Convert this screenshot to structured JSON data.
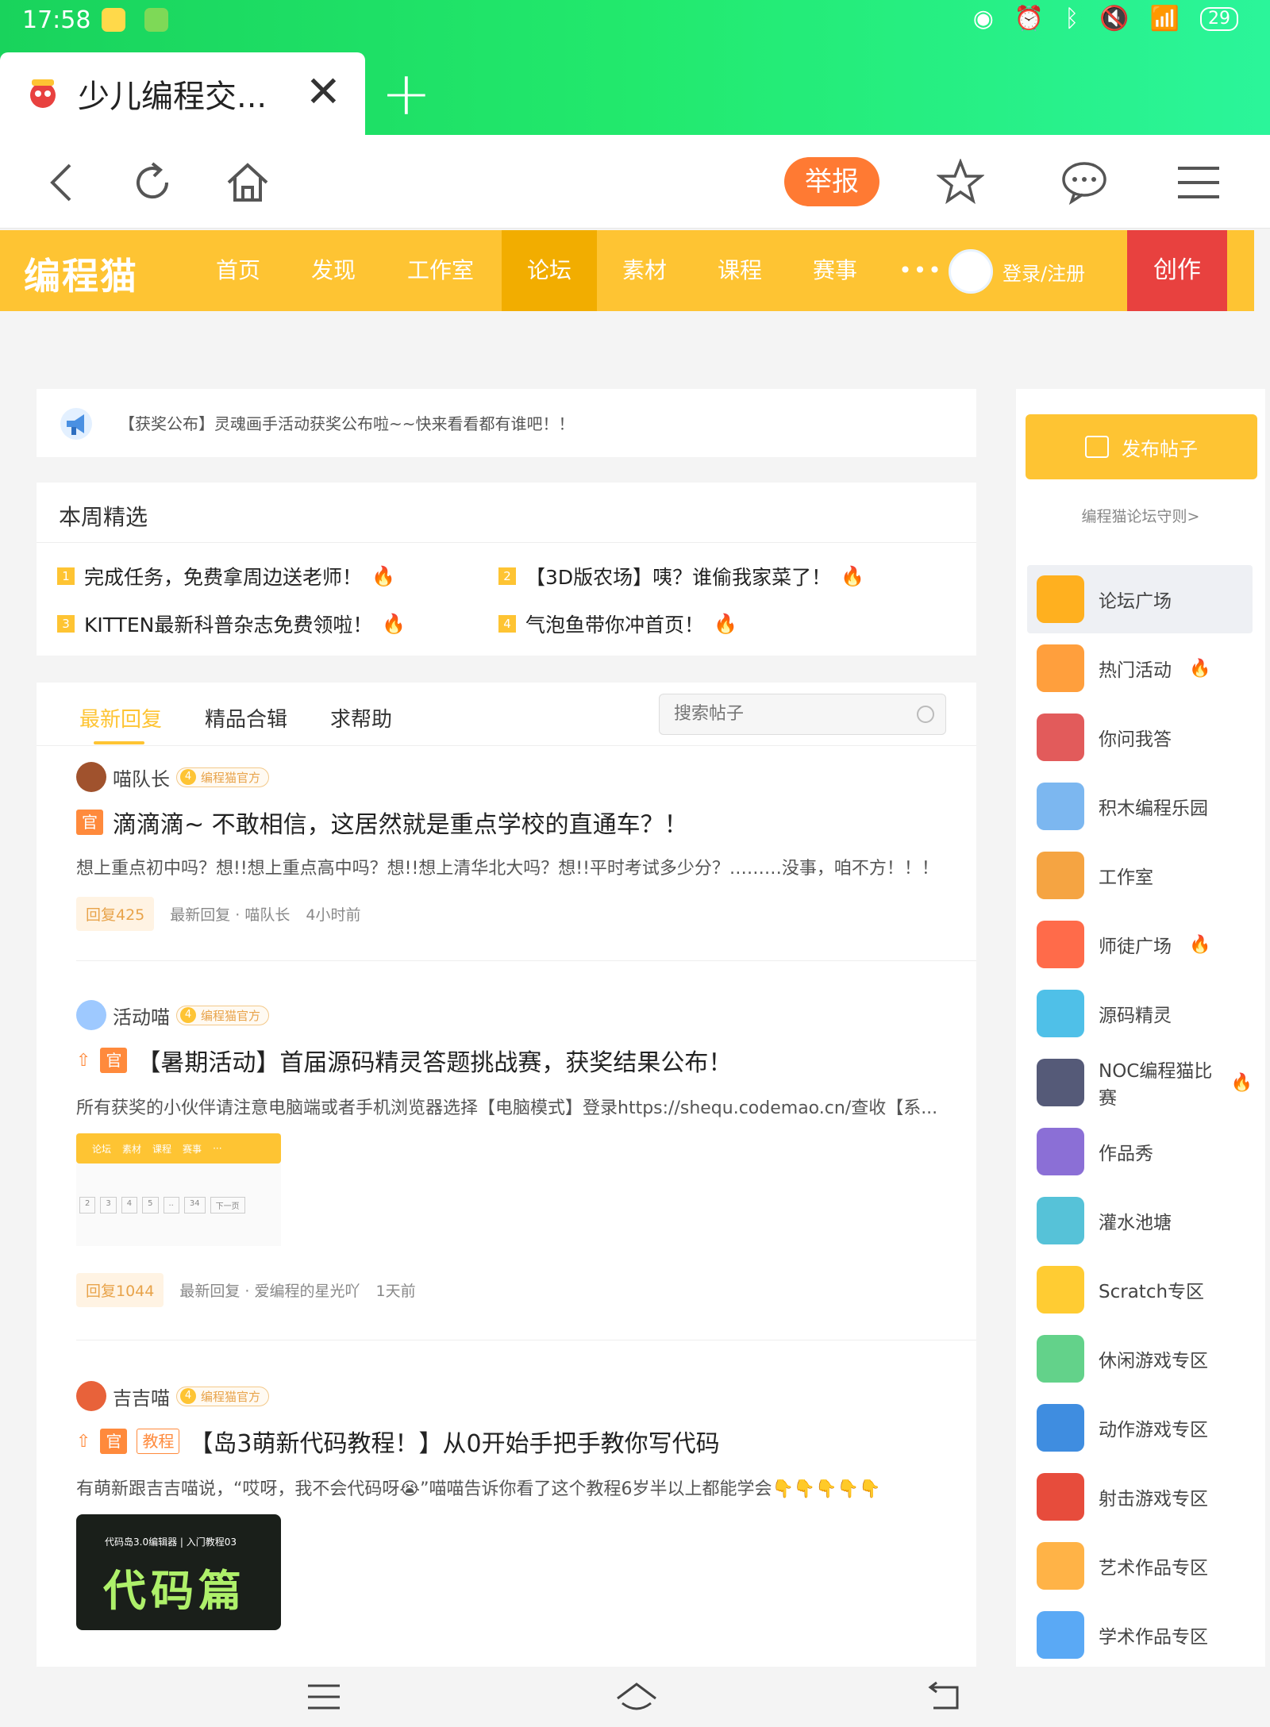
{
  "status_bar": {
    "time": "17:58",
    "battery": "29"
  },
  "browser": {
    "tab_title": "少儿编程交...",
    "close_symbol": "✕",
    "new_tab_symbol": "+",
    "report_label": "举报"
  },
  "site_nav": {
    "logo": "编程猫",
    "items": [
      "首页",
      "发现",
      "工作室",
      "论坛",
      "素材",
      "课程",
      "赛事"
    ],
    "active_item": "论坛",
    "more": "•••",
    "login": "登录/注册",
    "create": "创作",
    "brand_color": "#fec433",
    "create_color": "#e8413f"
  },
  "notice": {
    "text": "【获奖公布】灵魂画手活动获奖公布啦~~快来看看都有谁吧！！"
  },
  "weekly": {
    "title": "本周精选",
    "items": [
      {
        "num": "1",
        "text": "完成任务，免费拿周边送老师！"
      },
      {
        "num": "2",
        "text": "【3D版农场】咦？谁偷我家菜了！"
      },
      {
        "num": "3",
        "text": "KITTEN最新科普杂志免费领啦！"
      },
      {
        "num": "4",
        "text": "气泡鱼带你冲首页！"
      }
    ]
  },
  "posts_tabs": {
    "tabs": [
      "最新回复",
      "精品合辑",
      "求帮助"
    ],
    "active": "最新回复",
    "search_placeholder": "搜索帖子"
  },
  "posts": [
    {
      "author": "喵队长",
      "level": "4",
      "badge": "编程猫官方",
      "tag_guan": "官",
      "title": "滴滴滴~ 不敢相信，这居然就是重点学校的直通车？！",
      "excerpt": "想上重点初中吗？想!!想上重点高中吗？想!!想上清华北大吗？想!!平时考试多少分？………没事，咱不方！！！",
      "replies": "回复425",
      "last_reply": "最新回复 · 喵队长",
      "time": "4小时前"
    },
    {
      "author": "活动喵",
      "level": "4",
      "badge": "编程猫官方",
      "tag_guan": "官",
      "title": "【暑期活动】首届源码精灵答题挑战赛，获奖结果公布！",
      "excerpt": "所有获奖的小伙伴请注意电脑端或者手机浏览器选择【电脑模式】登录https://shequ.codemao.cn/查收【系...",
      "thumb_nav": [
        "论坛",
        "素材",
        "课程",
        "赛事",
        "···"
      ],
      "thumb_pages": [
        "2",
        "3",
        "4",
        "5",
        "..",
        "34",
        "下一页"
      ],
      "replies": "回复1044",
      "last_reply": "最新回复 · 爱编程的星光吖",
      "time": "1天前"
    },
    {
      "author": "吉吉喵",
      "level": "4",
      "badge": "编程猫官方",
      "tag_guan": "官",
      "tag_jiao": "教程",
      "title": "【岛3萌新代码教程！】从0开始手把手教你写代码",
      "excerpt": "有萌新跟吉吉喵说，“哎呀，我不会代码呀😭”喵喵告诉你看了这个教程6岁半以上都能学会👇👇👇👇👇",
      "thumb_top": "代码岛3.0编辑器 | 入门教程03",
      "thumb_big": "代码篇"
    }
  ],
  "sidebar": {
    "publish": "发布帖子",
    "rules": "编程猫论坛守则>",
    "items": [
      {
        "label": "论坛广场",
        "hot": false,
        "color": "#ffb01f"
      },
      {
        "label": "热门活动",
        "hot": true,
        "color": "#ff9f3d"
      },
      {
        "label": "你问我答",
        "hot": false,
        "color": "#e25b5b"
      },
      {
        "label": "积木编程乐园",
        "hot": false,
        "color": "#7cb7f0"
      },
      {
        "label": "工作室",
        "hot": false,
        "color": "#f5a442"
      },
      {
        "label": "师徒广场",
        "hot": true,
        "color": "#ff6b4a"
      },
      {
        "label": "源码精灵",
        "hot": false,
        "color": "#4fc0e8"
      },
      {
        "label": "NOC编程猫比赛",
        "hot": true,
        "color": "#555a78"
      },
      {
        "label": "作品秀",
        "hot": false,
        "color": "#8b6fd6"
      },
      {
        "label": "灌水池塘",
        "hot": false,
        "color": "#56c2d8"
      },
      {
        "label": "Scratch专区",
        "hot": false,
        "color": "#ffcc33"
      },
      {
        "label": "休闲游戏专区",
        "hot": false,
        "color": "#63d28a"
      },
      {
        "label": "动作游戏专区",
        "hot": false,
        "color": "#3f8de0"
      },
      {
        "label": "射击游戏专区",
        "hot": false,
        "color": "#e74c3c"
      },
      {
        "label": "艺术作品专区",
        "hot": false,
        "color": "#ffb347"
      },
      {
        "label": "学术作品专区",
        "hot": false,
        "color": "#5aa9f5"
      }
    ],
    "fire_symbol": "🔥"
  }
}
